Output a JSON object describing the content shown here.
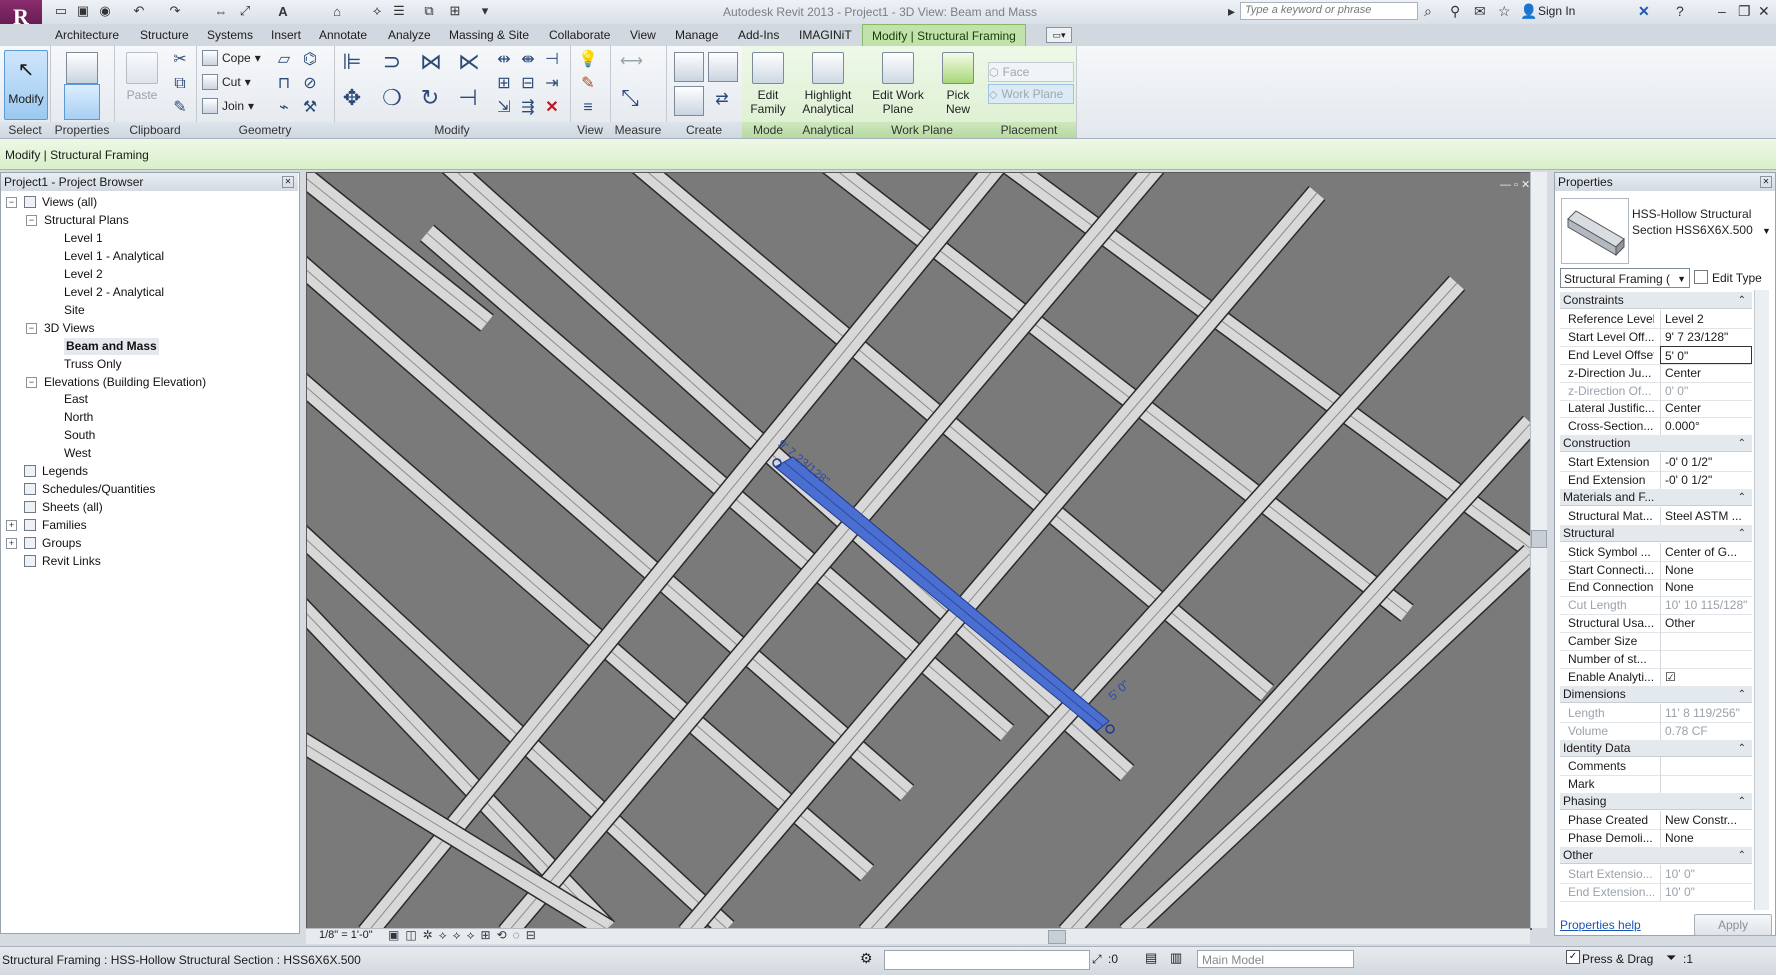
{
  "title_bar": {
    "window_title": "Autodesk Revit 2013 -     Project1 - 3D View: Beam and Mass",
    "search_placeholder": "Type a keyword or phrase",
    "sign_in": "Sign In"
  },
  "ribbon_tabs": [
    "Architecture",
    "Structure",
    "Systems",
    "Insert",
    "Annotate",
    "Analyze",
    "Massing & Site",
    "Collaborate",
    "View",
    "Manage",
    "Add-Ins",
    "IMAGINiT"
  ],
  "active_tab": "Modify | Structural Framing",
  "ribbon": {
    "select": {
      "modify_label": "Modify",
      "panel": "Select"
    },
    "properties": {
      "panel": "Properties"
    },
    "clipboard": {
      "paste_label": "Paste",
      "panel": "Clipboard"
    },
    "geometry": {
      "cope": "Cope",
      "cut": "Cut",
      "join": "Join",
      "panel": "Geometry"
    },
    "modify": {
      "panel": "Modify"
    },
    "view": {
      "panel": "View"
    },
    "measure": {
      "panel": "Measure"
    },
    "create": {
      "panel": "Create"
    },
    "mode": {
      "edit_family": "Edit Family",
      "panel": "Mode"
    },
    "analytical": {
      "highlight_analytical": "Highlight Analytical",
      "panel": "Analytical"
    },
    "work_plane": {
      "edit_work_plane": "Edit Work Plane",
      "pick_new": "Pick New",
      "panel": "Work Plane"
    },
    "placement": {
      "face": "Face",
      "work_plane": "Work Plane",
      "panel": "Placement"
    }
  },
  "options_bar": "Modify | Structural Framing",
  "project_browser": {
    "title": "Project1 - Project Browser",
    "items": [
      {
        "label": "Views (all)",
        "level": 0,
        "expander": "−",
        "icon": "views-icon"
      },
      {
        "label": "Structural Plans",
        "level": 1,
        "expander": "−"
      },
      {
        "label": "Level 1",
        "level": 2
      },
      {
        "label": "Level 1 - Analytical",
        "level": 2
      },
      {
        "label": "Level 2",
        "level": 2
      },
      {
        "label": "Level 2 - Analytical",
        "level": 2
      },
      {
        "label": "Site",
        "level": 2
      },
      {
        "label": "3D Views",
        "level": 1,
        "expander": "−"
      },
      {
        "label": "Beam and Mass",
        "level": 2,
        "bold": true
      },
      {
        "label": "Truss Only",
        "level": 2
      },
      {
        "label": "Elevations (Building Elevation)",
        "level": 1,
        "expander": "−"
      },
      {
        "label": "East",
        "level": 2
      },
      {
        "label": "North",
        "level": 2
      },
      {
        "label": "South",
        "level": 2
      },
      {
        "label": "West",
        "level": 2
      },
      {
        "label": "Legends",
        "level": 0,
        "icon": "legends-icon"
      },
      {
        "label": "Schedules/Quantities",
        "level": 0,
        "icon": "schedules-icon"
      },
      {
        "label": "Sheets (all)",
        "level": 0,
        "icon": "sheets-icon"
      },
      {
        "label": "Families",
        "level": 0,
        "expander": "+",
        "icon": "families-icon"
      },
      {
        "label": "Groups",
        "level": 0,
        "expander": "+",
        "icon": "groups-icon"
      },
      {
        "label": "Revit Links",
        "level": 0,
        "icon": "links-icon"
      }
    ]
  },
  "viewport": {
    "start_dim": "9' 7 23/128\"",
    "end_dim": "5' 0\"",
    "scale": "1/8\" = 1'-0\"",
    "colors": {
      "background": "#7a7a7a",
      "beam": "#d8d8d8",
      "selected": "#4a6fd0"
    }
  },
  "properties": {
    "title": "Properties",
    "type_name": "HSS-Hollow Structural Section HSS6X6X.500",
    "type_selector": "Structural Framing (",
    "edit_type": "Edit Type",
    "help": "Properties help",
    "apply": "Apply",
    "groups": [
      {
        "name": "Constraints",
        "rows": [
          {
            "name": "Reference Level",
            "value": "Level 2"
          },
          {
            "name": "Start Level Off...",
            "value": "9' 7 23/128\""
          },
          {
            "name": "End Level Offset",
            "value": "5' 0\"",
            "editing": true
          },
          {
            "name": "z-Direction Ju...",
            "value": "Center"
          },
          {
            "name": "z-Direction Of...",
            "value": "0' 0\"",
            "dim": true
          },
          {
            "name": "Lateral Justific...",
            "value": "Center"
          },
          {
            "name": "Cross-Section...",
            "value": "0.000°"
          }
        ]
      },
      {
        "name": "Construction",
        "rows": [
          {
            "name": "Start Extension",
            "value": "-0' 0 1/2\""
          },
          {
            "name": "End Extension",
            "value": "-0' 0 1/2\""
          }
        ]
      },
      {
        "name": "Materials and F...",
        "rows": [
          {
            "name": "Structural Mat...",
            "value": "Steel ASTM ..."
          }
        ]
      },
      {
        "name": "Structural",
        "rows": [
          {
            "name": "Stick Symbol ...",
            "value": "Center of G..."
          },
          {
            "name": "Start Connecti...",
            "value": "None"
          },
          {
            "name": "End Connection",
            "value": "None"
          },
          {
            "name": "Cut Length",
            "value": "10' 10 115/128\"",
            "dim": true
          },
          {
            "name": "Structural Usa...",
            "value": "Other"
          },
          {
            "name": "Camber Size",
            "value": ""
          },
          {
            "name": "Number of st...",
            "value": ""
          },
          {
            "name": "Enable Analyti...",
            "value": "☑"
          }
        ]
      },
      {
        "name": "Dimensions",
        "rows": [
          {
            "name": "Length",
            "value": "11' 8 119/256\"",
            "dim": true
          },
          {
            "name": "Volume",
            "value": "0.78 CF",
            "dim": true
          }
        ]
      },
      {
        "name": "Identity Data",
        "rows": [
          {
            "name": "Comments",
            "value": ""
          },
          {
            "name": "Mark",
            "value": ""
          }
        ]
      },
      {
        "name": "Phasing",
        "rows": [
          {
            "name": "Phase Created",
            "value": "New Constr..."
          },
          {
            "name": "Phase Demoli...",
            "value": "None"
          }
        ]
      },
      {
        "name": "Other",
        "rows": [
          {
            "name": "Start Extensio...",
            "value": "10' 0\"",
            "dim": true
          },
          {
            "name": "End Extension...",
            "value": "10' 0\"",
            "dim": true
          }
        ]
      }
    ]
  },
  "status_bar": {
    "text": "Structural Framing : HSS-Hollow Structural Section : HSS6X6X.500",
    "coord": ":0",
    "model": "Main Model",
    "press_drag": "Press & Drag",
    "filter_count": ":1"
  }
}
